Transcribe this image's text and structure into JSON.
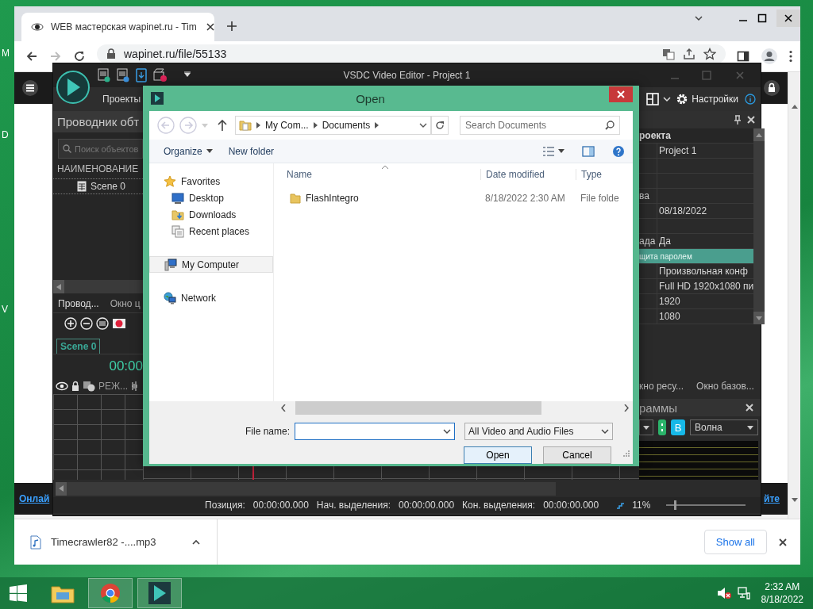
{
  "desktop": {
    "icon_labels": [
      "M",
      "D",
      "V"
    ]
  },
  "browser": {
    "tab": {
      "title": "WEB мастерская wapinet.ru - Tim"
    },
    "url": "wapinet.ru/file/55133",
    "footer_links": [
      "Онлай",
      "йте"
    ],
    "download": {
      "filename": "Timecrawler82 -....mp3",
      "show_all": "Show all"
    }
  },
  "editor": {
    "title": "VSDC Video Editor - Project 1",
    "menu": [
      "Проекты"
    ],
    "settings": "Настройки",
    "explorer": {
      "title": "Проводник обт",
      "search_placeholder": "Поиск объектов",
      "column": "НАИМЕНОВАНИЕ",
      "items": [
        "Scene 0"
      ],
      "tabs": [
        {
          "label": "Провод...",
          "selected": true
        },
        {
          "label": "Окно ц",
          "selected": false
        }
      ]
    },
    "timeline": {
      "scene_tab": "Scene 0",
      "time": "00:00",
      "track_mode": "РЕЖ..."
    },
    "properties": {
      "rows": [
        {
          "kind": "header",
          "label": "роекта",
          "value": "",
          "selected": false
        },
        {
          "kind": "row",
          "label": "",
          "value": "Project 1",
          "selected": false
        },
        {
          "kind": "row",
          "label": "",
          "value": "",
          "selected": false
        },
        {
          "kind": "row",
          "label": "",
          "value": "",
          "selected": false
        },
        {
          "kind": "row",
          "label": "ва",
          "value": "",
          "selected": false
        },
        {
          "kind": "row",
          "label": "",
          "value": "08/18/2022",
          "selected": false
        },
        {
          "kind": "row",
          "label": "",
          "value": "",
          "selected": false
        },
        {
          "kind": "row",
          "label": "ада",
          "value": "Да",
          "selected": false
        },
        {
          "kind": "section",
          "label": "щита паролем",
          "value": "",
          "selected": true
        },
        {
          "kind": "row",
          "label": "",
          "value": "Произвольная конф",
          "selected": false
        },
        {
          "kind": "row",
          "label": "",
          "value": "Full HD 1920x1080 пи",
          "selected": false
        },
        {
          "kind": "row",
          "label": "",
          "value": "1920",
          "selected": false
        },
        {
          "kind": "row",
          "label": "",
          "value": "1080",
          "selected": false
        }
      ]
    },
    "panel_tabs": [
      {
        "label": "кно ресу...",
        "selected": false
      },
      {
        "label": "Окно базов...",
        "selected": false
      }
    ],
    "waveform": {
      "title": "раммы",
      "button": "В",
      "mode": "Волна"
    },
    "status": {
      "position_label": "Позиция:",
      "position": "00:00:00.000",
      "sel_start_label": "Нач. выделения:",
      "sel_start": "00:00:00.000",
      "sel_end_label": "Кон. выделения:",
      "sel_end": "00:00:00.000",
      "zoom": "11%"
    },
    "zoom_slider": {
      "level": 0.1
    }
  },
  "dialog": {
    "title": "Open",
    "breadcrumb": [
      "My Com...",
      "Documents"
    ],
    "search_placeholder": "Search Documents",
    "toolbar": [
      "Organize",
      "New folder"
    ],
    "nav": [
      {
        "label": "Favorites",
        "selected": false,
        "children": [
          {
            "label": "Desktop",
            "selected": false
          },
          {
            "label": "Downloads",
            "selected": false
          },
          {
            "label": "Recent places",
            "selected": false
          }
        ]
      },
      {
        "label": "My Computer",
        "selected": true
      },
      {
        "label": "Network",
        "selected": false
      }
    ],
    "columns": [
      "Name",
      "Date modified",
      "Type"
    ],
    "files": [
      {
        "name": "FlashIntegro",
        "date": "8/18/2022 2:30 AM",
        "type": "File folde"
      }
    ],
    "file_name_label": "File name:",
    "filter": "All Video and Audio Files",
    "buttons": [
      "Open",
      "Cancel"
    ]
  },
  "taskbar": {
    "time": "2:32 AM",
    "date": "8/18/2022"
  }
}
